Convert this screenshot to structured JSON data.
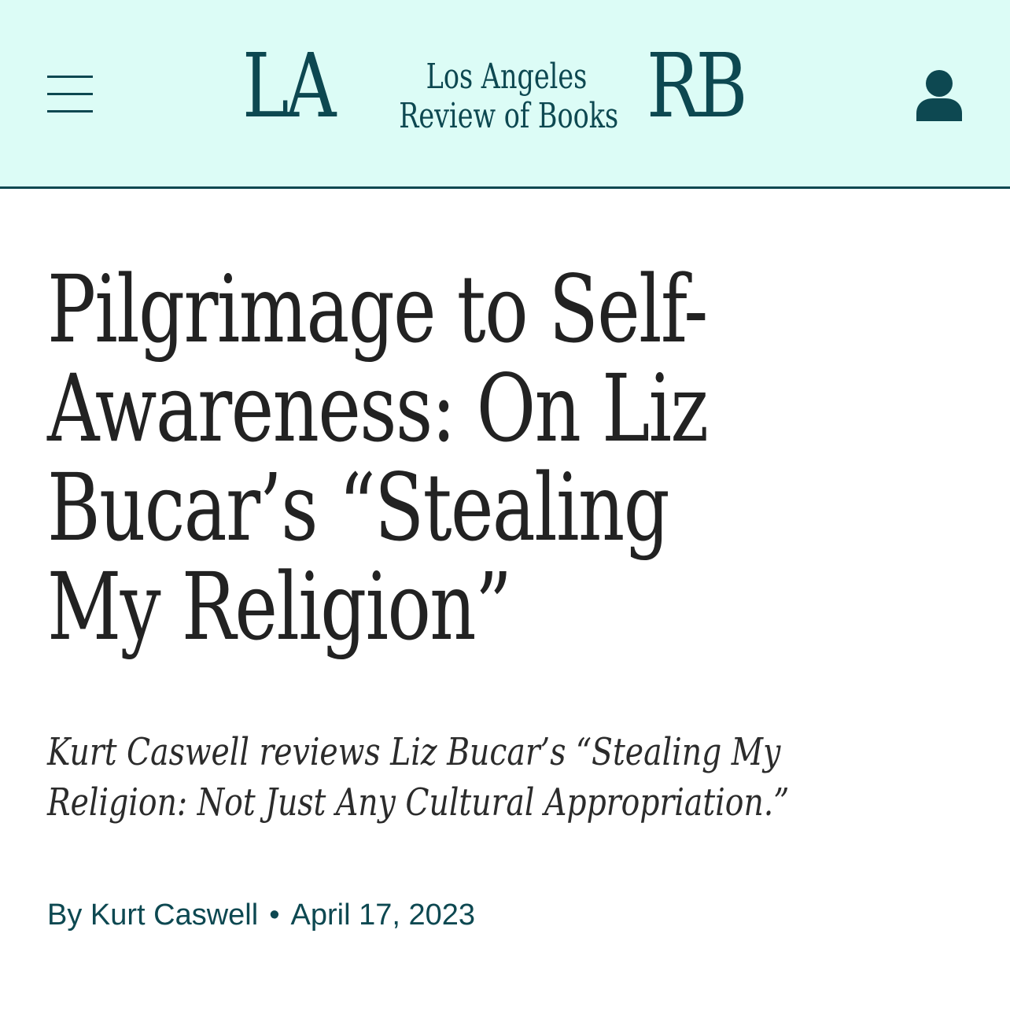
{
  "header": {
    "logo": {
      "left_letters": "LA",
      "right_letters": "RB",
      "line1": "Los Angeles",
      "line2": "Review of Books"
    },
    "menu_icon": "hamburger-menu-icon",
    "account_icon": "user-icon"
  },
  "article": {
    "headline": "Pilgrimage to Self-Awareness: On Liz Bucar’s “Stealing My Religion”",
    "dek": "Kurt Caswell reviews Liz Bucar’s “Stealing My Religion: Not Just Any Cultural Appropriation.”",
    "byline": {
      "author": "By Kurt Caswell",
      "separator": "•",
      "date": "April 17, 2023"
    }
  },
  "colors": {
    "header_bg": "#dcfcf6",
    "brand": "#0d4851",
    "text": "#222222"
  }
}
